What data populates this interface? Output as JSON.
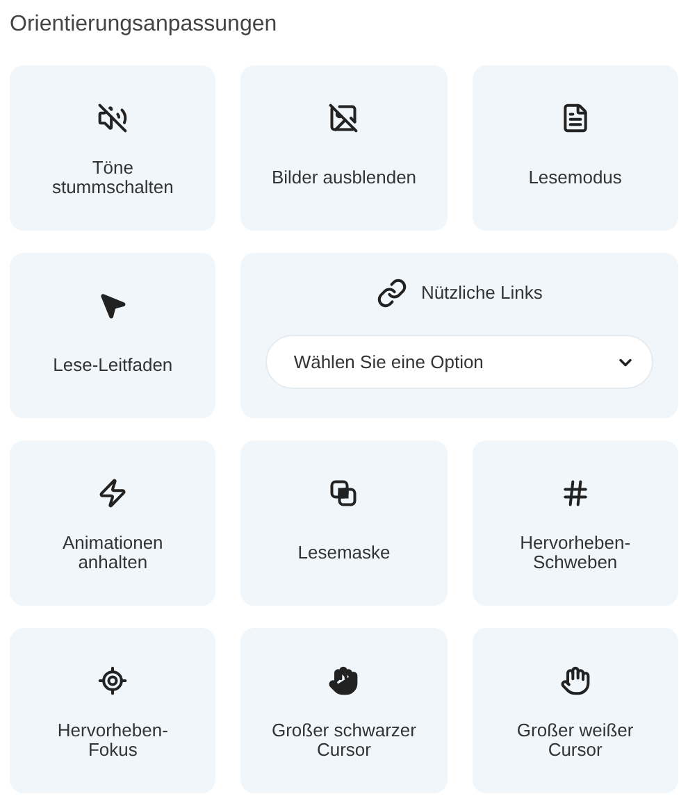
{
  "title": "Orientierungsanpassungen",
  "cards": [
    {
      "kind": "tile",
      "label": "Töne\nstummschalten"
    },
    {
      "kind": "tile",
      "label": "Bilder ausblenden"
    },
    {
      "kind": "tile",
      "label": "Lesemodus"
    },
    {
      "kind": "tile",
      "label": "Lese-Leitfaden"
    },
    {
      "kind": "links",
      "label": "Nützliche Links",
      "select": {
        "value": "Wählen Sie eine Option"
      }
    },
    {
      "kind": "tile",
      "label": "Animationen\nanhalten"
    },
    {
      "kind": "tile",
      "label": "Lesemaske"
    },
    {
      "kind": "tile",
      "label": "Hervorheben-\nSchweben"
    },
    {
      "kind": "tile",
      "label": "Hervorheben-\nFokus"
    },
    {
      "kind": "tile",
      "label": "Großer schwarzer\nCursor"
    },
    {
      "kind": "tile",
      "label": "Großer weißer\nCursor"
    }
  ]
}
